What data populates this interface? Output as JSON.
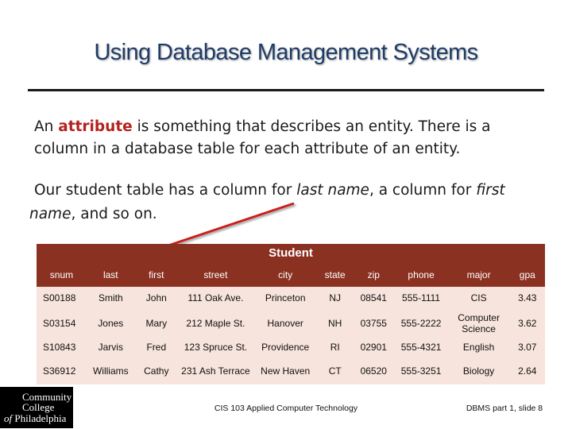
{
  "slide": {
    "title": "Using Database Management Systems",
    "para1": {
      "before": "An ",
      "highlight": "attribute",
      "after": " is something that describes an entity.  There is a column in a database table for each attribute of an entity."
    },
    "para2": {
      "t1": "Our student table has a column for ",
      "i1": "last name",
      "t2": ", a column for ",
      "i2": "first name",
      "t3": ", and so on."
    },
    "accent_color": "#b3221e",
    "arrow_color": "#cc1f1a"
  },
  "table": {
    "title": "Student",
    "header_color": "#8b3121",
    "row_color": "#f7e4dc",
    "columns": [
      "snum",
      "last",
      "first",
      "street",
      "city",
      "state",
      "zip",
      "phone",
      "major",
      "gpa"
    ],
    "rows": [
      [
        "S00188",
        "Smith",
        "John",
        "111 Oak Ave.",
        "Princeton",
        "NJ",
        "08541",
        "555-1111",
        "CIS",
        "3.43"
      ],
      [
        "S03154",
        "Jones",
        "Mary",
        "212 Maple St.",
        "Hanover",
        "NH",
        "03755",
        "555-2222",
        "Computer Science",
        "3.62"
      ],
      [
        "S10843",
        "Jarvis",
        "Fred",
        "123 Spruce St.",
        "Providence",
        "RI",
        "02901",
        "555-4321",
        "English",
        "3.07"
      ],
      [
        "S36912",
        "Williams",
        "Cathy",
        "231 Ash Terrace",
        "New Haven",
        "CT",
        "06520",
        "555-3251",
        "Biology",
        "2.64"
      ]
    ]
  },
  "logo": {
    "line1": "Community",
    "line2": "College",
    "line3a": "of",
    "line3b": "Philadelphia"
  },
  "footer": {
    "center": "CIS 103 Applied Computer Technology",
    "right": "DBMS part 1, slide 8"
  }
}
